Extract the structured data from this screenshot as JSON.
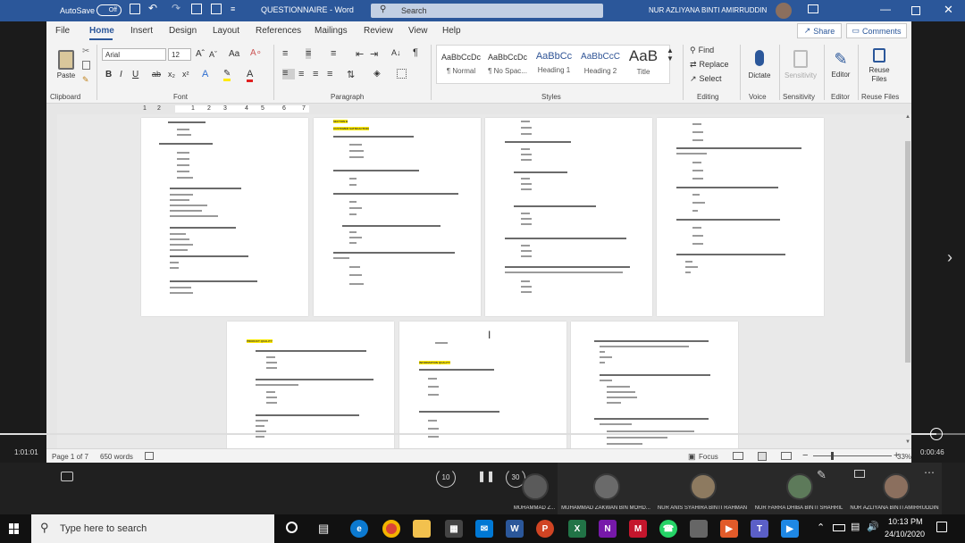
{
  "titlebar": {
    "autosave_label": "AutoSave",
    "autosave_state": "Off",
    "document_title": "QUESTIONNAIRE  -  Word",
    "search_placeholder": "Search",
    "user_name": "NUR AZLIYANA BINTI AMIRRUDDIN"
  },
  "ribbon_tabs": {
    "items": [
      "File",
      "Home",
      "Insert",
      "Design",
      "Layout",
      "References",
      "Mailings",
      "Review",
      "View",
      "Help"
    ],
    "active": "Home",
    "share": "Share",
    "comments": "Comments"
  },
  "ribbon": {
    "clipboard": {
      "label": "Clipboard",
      "paste": "Paste"
    },
    "font": {
      "label": "Font",
      "name": "Arial",
      "size": "12"
    },
    "paragraph": {
      "label": "Paragraph"
    },
    "styles": {
      "label": "Styles",
      "items": [
        {
          "preview": "AaBbCcDc",
          "name": "¶ Normal"
        },
        {
          "preview": "AaBbCcDc",
          "name": "¶ No Spac..."
        },
        {
          "preview": "AaBbCc",
          "name": "Heading 1"
        },
        {
          "preview": "AaBbCcC",
          "name": "Heading 2"
        },
        {
          "preview": "AaB",
          "name": "Title"
        }
      ]
    },
    "editing": {
      "label": "Editing",
      "find": "Find",
      "replace": "Replace",
      "select": "Select"
    },
    "voice": {
      "label": "Voice",
      "dictate": "Dictate"
    },
    "sensitivity": {
      "label": "Sensitivity",
      "button": "Sensitivity"
    },
    "editor": {
      "label": "Editor",
      "button": "Editor"
    },
    "reuse": {
      "label": "Reuse Files",
      "button": "Reuse Files"
    }
  },
  "ruler": {
    "marks": [
      "1",
      "2",
      "1",
      "2",
      "3",
      "4",
      "5",
      "6",
      "7"
    ]
  },
  "document": {
    "headings": {
      "section_b": "SECTION B",
      "customer_satisfaction": "CUSTOMER SATISFACTION",
      "product_quality": "PRODUCT QUALITY",
      "information_quality": "INFORMATION QUALITY"
    }
  },
  "statusbar": {
    "page": "Page 1 of 7",
    "words": "650 words",
    "focus": "Focus",
    "zoom": "33%"
  },
  "video": {
    "elapsed": "1:01:01",
    "remaining": "0:00:46",
    "progress_fraction": 0.97,
    "rewind_seconds": "10",
    "forward_seconds": "30"
  },
  "participants": [
    {
      "name": "MUHAMMAD Z..."
    },
    {
      "name": "MUHAMMAD ZAKWAN BIN MOHD..."
    },
    {
      "name": "NUR ANIS SYAHIRA BINTI RAHMAN"
    },
    {
      "name": "NUR FARRA DHIBA BINTI SHAHRIL"
    },
    {
      "name": "NUR AZLIYANA BINTI AMIRRUDDIN"
    }
  ],
  "taskbar": {
    "search_placeholder": "Type here to search",
    "time": "10:13 PM",
    "date": "24/10/2020"
  },
  "colors": {
    "word_blue": "#2b579a",
    "highlight": "#ffea00",
    "taskbar": "#111111"
  }
}
